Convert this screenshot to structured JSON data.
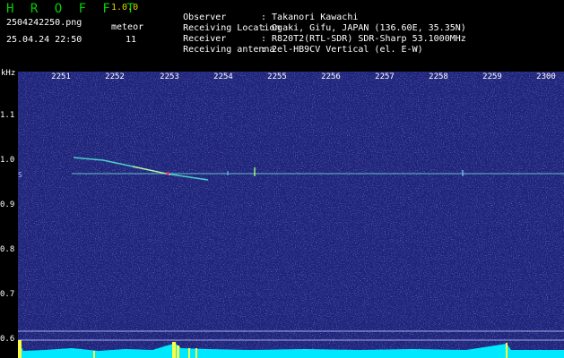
{
  "header": {
    "app_title": "H R O F F T",
    "version": "1.0.0",
    "filename": "2504242250.png",
    "datetime": "25.04.24 22:50",
    "meteor_label": "meteor",
    "meteor_count": "11",
    "info": [
      {
        "key": "Observer",
        "value": ": Takanori Kawachi"
      },
      {
        "key": "Receiving Location",
        "value": ": Ogaki, Gifu, JAPAN (136.60E, 35.35N)"
      },
      {
        "key": "Receiver",
        "value": ": R820T2(RTL-SDR) SDR-Sharp 53.1000MHz"
      },
      {
        "key": "Receiving antenna",
        "value": ": 2el-HB9CV Vertical (el. E-W)"
      }
    ]
  },
  "spectrogram": {
    "y_unit": "kHz",
    "y_ticks": [
      "1.1",
      "1.0",
      "0.9",
      "0.8",
      "0.7",
      "0.6"
    ],
    "x_ticks": [
      "2251",
      "2252",
      "2253",
      "2254",
      "2255",
      "2256",
      "2257",
      "2258",
      "2259",
      "2300"
    ],
    "colors": {
      "background": "#1f247a",
      "carrier": "#5fb0c0",
      "echo": "#50e0d0",
      "bar": "#00e8ff",
      "burst": "#ffff40"
    }
  }
}
